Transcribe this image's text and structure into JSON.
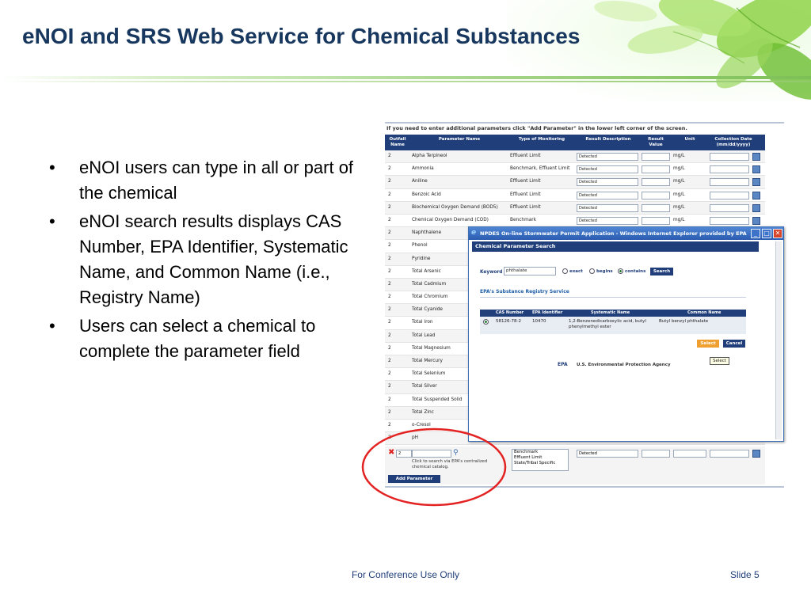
{
  "slide": {
    "title": "eNOI and SRS Web Service for Chemical Substances",
    "footer": "For Conference Use Only",
    "number": "Slide 5"
  },
  "bullets": [
    "eNOI users can type in all or part of the chemical",
    "eNOI search results displays CAS Number, EPA Identifier, Systematic Name, and Common Name (i.e., Registry Name)",
    "Users can select a chemical to complete the parameter field"
  ],
  "screenshot": {
    "instruction": "If you need to enter additional parameters click \"Add Parameter\" in the lower left corner of the screen.",
    "columns": {
      "outfall": "Outfall Name",
      "parameter": "Parameter Name",
      "monitoring": "Type of Monitoring",
      "result_desc": "Result Description",
      "result_value": "Result Value",
      "unit": "Unit",
      "collection": "Collection Date (mm/dd/yyyy)"
    },
    "rows": [
      {
        "outfall": "2",
        "param": "Alpha Terpineol",
        "type": "Effluent Limit",
        "desc": "Detected",
        "unit": "mg/L"
      },
      {
        "outfall": "2",
        "param": "Ammonia",
        "type": "Benchmark, Effluent Limit",
        "desc": "Detected",
        "unit": "mg/L"
      },
      {
        "outfall": "2",
        "param": "Aniline",
        "type": "Effluent Limit",
        "desc": "Detected",
        "unit": "mg/L"
      },
      {
        "outfall": "2",
        "param": "Benzoic Acid",
        "type": "Effluent Limit",
        "desc": "Detected",
        "unit": "mg/L"
      },
      {
        "outfall": "2",
        "param": "Biochemical Oxygen Demand (BOD5)",
        "type": "Effluent Limit",
        "desc": "Detected",
        "unit": "mg/L"
      },
      {
        "outfall": "2",
        "param": "Chemical Oxygen Demand (COD)",
        "type": "Benchmark",
        "desc": "Detected",
        "unit": "mg/L"
      },
      {
        "outfall": "2",
        "param": "Naphthalene",
        "type": "",
        "desc": "",
        "unit": ""
      },
      {
        "outfall": "2",
        "param": "Phenol",
        "type": "",
        "desc": "",
        "unit": ""
      },
      {
        "outfall": "2",
        "param": "Pyridine",
        "type": "",
        "desc": "",
        "unit": ""
      },
      {
        "outfall": "2",
        "param": "Total Arsenic",
        "type": "",
        "desc": "",
        "unit": ""
      },
      {
        "outfall": "2",
        "param": "Total Cadmium",
        "type": "",
        "desc": "",
        "unit": ""
      },
      {
        "outfall": "2",
        "param": "Total Chromium",
        "type": "",
        "desc": "",
        "unit": ""
      },
      {
        "outfall": "2",
        "param": "Total Cyanide",
        "type": "",
        "desc": "",
        "unit": ""
      },
      {
        "outfall": "2",
        "param": "Total Iron",
        "type": "",
        "desc": "",
        "unit": ""
      },
      {
        "outfall": "2",
        "param": "Total Lead",
        "type": "",
        "desc": "",
        "unit": ""
      },
      {
        "outfall": "2",
        "param": "Total Magnesium",
        "type": "",
        "desc": "",
        "unit": ""
      },
      {
        "outfall": "2",
        "param": "Total Mercury",
        "type": "",
        "desc": "",
        "unit": ""
      },
      {
        "outfall": "2",
        "param": "Total Selenium",
        "type": "",
        "desc": "",
        "unit": ""
      },
      {
        "outfall": "2",
        "param": "Total Silver",
        "type": "",
        "desc": "",
        "unit": ""
      },
      {
        "outfall": "2",
        "param": "Total Suspended Solid",
        "type": "",
        "desc": "",
        "unit": ""
      },
      {
        "outfall": "2",
        "param": "Total Zinc",
        "type": "",
        "desc": "",
        "unit": ""
      },
      {
        "outfall": "2",
        "param": "o-Cresol",
        "type": "",
        "desc": "",
        "unit": ""
      },
      {
        "outfall": "2",
        "param": "pH",
        "type": "",
        "desc": "",
        "unit": ""
      }
    ],
    "new_row": {
      "outfall": "2",
      "hint": "Click to search via EPA's centralized chemical catalog.",
      "type_options": [
        "Benchmark",
        "Effluent Limit",
        "State/Tribal Specific"
      ],
      "desc": "Detected"
    },
    "add_parameter": "Add Parameter"
  },
  "popup": {
    "window_title": "NPDES On-line Stormwater Permit Application - Windows Internet Explorer provided by EPA",
    "heading": "Chemical Parameter Search",
    "keyword_label": "Keyword",
    "keyword_value": "phthalate",
    "options": [
      "exact",
      "begins",
      "contains"
    ],
    "selected_option": "contains",
    "search_button": "Search",
    "registry_heading": "EPA's Substance Registry Service",
    "result_headers": [
      "CAS Number",
      "EPA Identifier",
      "Systematic Name",
      "Common Name"
    ],
    "results": [
      {
        "cas": "58126-78-2",
        "epa_id": "10470",
        "systematic": "1,2-Benzenedicarboxylic acid, butyl phenylmethyl ester",
        "common": "Butyl benzyl phthalate"
      }
    ],
    "select_button": "Select",
    "cancel_button": "Cancel",
    "agency_logo": "EPA",
    "agency_name": "U.S. Environmental Protection Agency",
    "tooltip": "Select"
  },
  "colors": {
    "title": "#17375e",
    "grid_header": "#1f3e7a",
    "annotation": "#e32222",
    "select_button": "#f0a030"
  }
}
